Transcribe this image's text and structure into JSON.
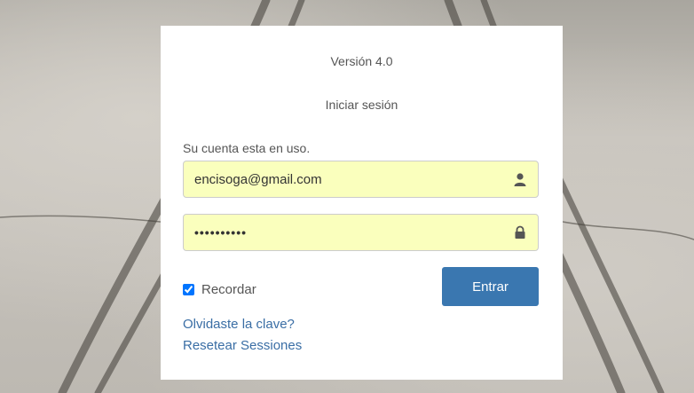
{
  "login": {
    "version": "Versión 4.0",
    "title": "Iniciar sesión",
    "status": "Su cuenta esta en uso.",
    "email_value": "encisoga@gmail.com",
    "password_value": "••••••••••",
    "remember_label": "Recordar",
    "remember_checked": true,
    "enter_label": "Entrar",
    "forgot_link": "Olvidaste la clave?",
    "reset_link": "Resetear Sessiones"
  },
  "icons": {
    "email": "user-icon",
    "password": "lock-icon",
    "remember": "checkbox-checked"
  },
  "colors": {
    "accent": "#3a77b0",
    "link": "#3a6ea5",
    "autofill": "#faffbd"
  }
}
